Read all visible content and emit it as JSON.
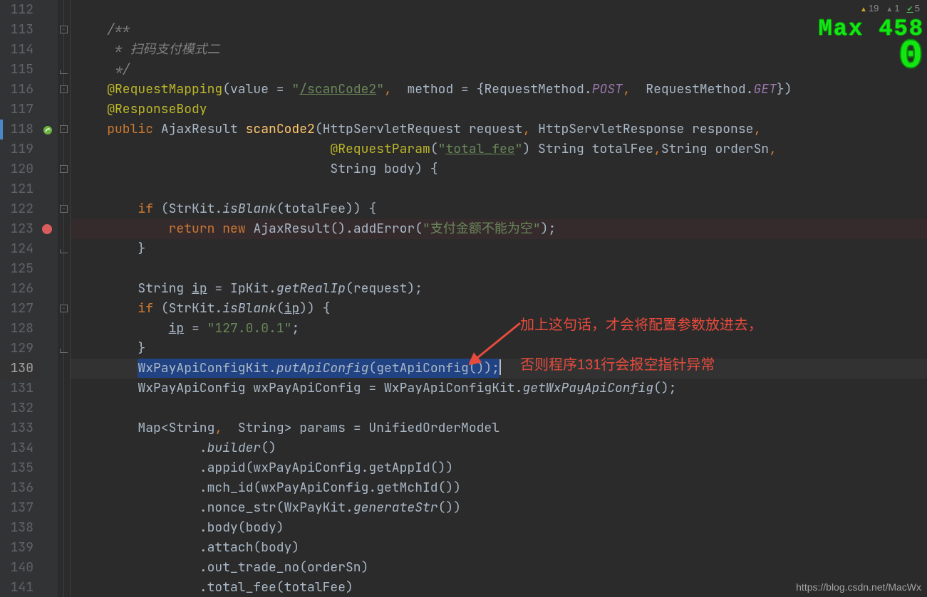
{
  "status": {
    "warn": "19",
    "weak": "1",
    "typo": "5"
  },
  "pixel": {
    "line1": "Max 458",
    "line2": "0"
  },
  "lines": {
    "start": 112,
    "end": 141,
    "current": 130,
    "breakpoint": 123,
    "icon_line": 118
  },
  "annotations": {
    "a1": "加上这句话，才会将配置参数放进去，",
    "a2": "否则程序131行会报空指针异常"
  },
  "watermark": "https://blog.csdn.net/MacWx",
  "code": {
    "l112": "",
    "l113_a": "/**",
    "l114_a": " * 扫码支付模式二",
    "l115_a": " */",
    "l116_ann": "@RequestMapping",
    "l116_b": "(value = ",
    "l116_str_q": "\"",
    "l116_str": "/scanCode2",
    "l116_c": ", ",
    "l116_d": "method = {RequestMethod.",
    "l116_post": "POST",
    "l116_e": ",  RequestMethod.",
    "l116_get": "GET",
    "l116_f": "})",
    "l117_ann": "@ResponseBody",
    "l118_kw": "public",
    "l118_b": " AjaxResult ",
    "l118_fn": "scanCode2",
    "l118_c": "(HttpServletRequest request",
    "l118_d": ", ",
    "l118_e": "HttpServletResponse ",
    "l118_f": "response",
    "l118_g": ",",
    "l119_ann": "@RequestParam",
    "l119_b": "(",
    "l119_str_q": "\"",
    "l119_str": "total_fee",
    "l119_c": ") String totalFee",
    "l119_d": ",",
    "l119_e": "String orderSn",
    "l119_f": ",",
    "l120_a": "String body) {",
    "l121": "",
    "l122_kw": "if",
    "l122_b": " (StrKit.",
    "l122_it": "isBlank",
    "l122_c": "(totalFee)) {",
    "l123_kw1": "return",
    "l123_kw2": "new",
    "l123_a": " AjaxResult().addError(",
    "l123_str": "\"支付金额不能为空\"",
    "l123_b": ");",
    "l124_a": "}",
    "l125": "",
    "l126_a": "String ",
    "l126_ip": "ip",
    "l126_b": " = IpKit.",
    "l126_it": "getRealIp",
    "l126_c": "(request);",
    "l127_kw": "if",
    "l127_a": " (StrKit.",
    "l127_it": "isBlank",
    "l127_b": "(",
    "l127_ip": "ip",
    "l127_c": ")) {",
    "l128_ip": "ip",
    "l128_a": " = ",
    "l128_str": "\"127.0.0.1\"",
    "l128_b": ";",
    "l129_a": "}",
    "l130_a": "WxPayApiConfigKit.",
    "l130_it": "putApiConfig",
    "l130_b": "(getApiConfig());",
    "l131_a": "WxPayApiConfig wxPayApiConfig = WxPayApiConfigKit.",
    "l131_it": "getWxPayApiConfig",
    "l131_b": "();",
    "l132": "",
    "l133_a": "Map<String",
    "l133_b": ",  ",
    "l133_c": "String> params = UnifiedOrderModel",
    "l134_a": ".",
    "l134_it": "builder",
    "l134_b": "()",
    "l135_a": ".appid(wxPayApiConfig.getAppId())",
    "l136_a": ".mch_id(wxPayApiConfig.getMchId())",
    "l137_a": ".nonce_str(WxPayKit.",
    "l137_it": "generateStr",
    "l137_b": "())",
    "l138_a": ".body(body)",
    "l139_a": ".attach(body)",
    "l140_a": ".out_trade_no(orderSn)",
    "l141_a": ".total_fee(totalFee)"
  }
}
